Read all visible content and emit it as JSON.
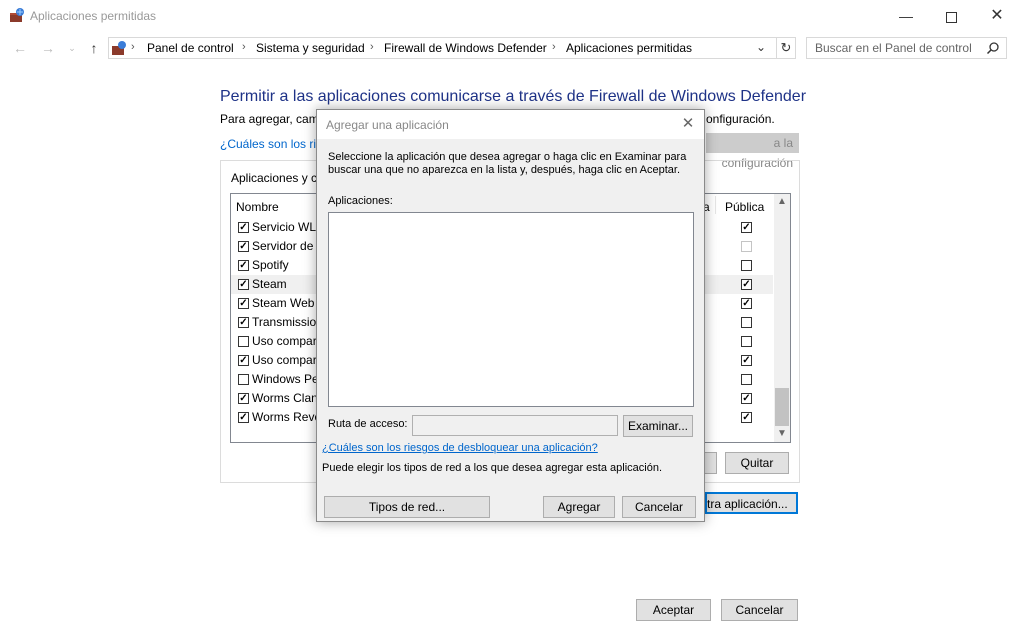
{
  "window": {
    "title": "Aplicaciones permitidas",
    "controls": [
      "minimize-icon",
      "maximize-icon",
      "close-icon"
    ]
  },
  "nav": {
    "breadcrumb": [
      "Panel de control",
      "Sistema y seguridad",
      "Firewall de Windows Defender",
      "Aplicaciones permitidas"
    ],
    "search_placeholder": "Buscar en el Panel de control"
  },
  "main": {
    "title": "Permitir a las aplicaciones comunicarse a través de Firewall de Windows Defender",
    "subtitle_start": "Para agregar, camb",
    "subtitle_end": "onfiguración.",
    "risk_link": "¿Cuáles son los ries",
    "change_settings": "a la configuración",
    "group_label": "Aplicaciones y c",
    "columns": {
      "name": "Nombre",
      "private_partial": "a",
      "public": "Pública"
    },
    "apps": [
      {
        "name": "Servicio WLA",
        "enabled": true,
        "public": true,
        "public_disabled": false
      },
      {
        "name": "Servidor de p",
        "enabled": true,
        "public": false,
        "public_disabled": true
      },
      {
        "name": "Spotify",
        "enabled": true,
        "public": false,
        "public_disabled": false
      },
      {
        "name": "Steam",
        "enabled": true,
        "public": true,
        "public_disabled": false,
        "selected": true
      },
      {
        "name": "Steam Web H",
        "enabled": true,
        "public": true,
        "public_disabled": false
      },
      {
        "name": "Transmission",
        "enabled": true,
        "public": false,
        "public_disabled": false
      },
      {
        "name": "Uso compar",
        "enabled": false,
        "public": false,
        "public_disabled": false
      },
      {
        "name": "Uso compar",
        "enabled": true,
        "public": true,
        "public_disabled": false
      },
      {
        "name": "Windows Pe",
        "enabled": false,
        "public": false,
        "public_disabled": false
      },
      {
        "name": "Worms Clan",
        "enabled": true,
        "public": true,
        "public_disabled": false
      },
      {
        "name": "Worms Revo",
        "enabled": true,
        "public": true,
        "public_disabled": false
      }
    ],
    "remove_button": "Quitar",
    "allow_other_button": "tra aplicación...",
    "ok_button": "Aceptar",
    "cancel_button": "Cancelar"
  },
  "dialog": {
    "title": "Agregar una aplicación",
    "instruction_line1": "Seleccione la aplicación que desea agregar o haga clic en Examinar para",
    "instruction_line2": "buscar una que no aparezca en la lista y, después, haga clic en Aceptar.",
    "apps_label": "Aplicaciones:",
    "path_label": "Ruta de acceso:",
    "path_value": "",
    "browse_button": "Examinar...",
    "risk_link": "¿Cuáles son los riesgos de desbloquear una aplicación?",
    "network_text": "Puede elegir los tipos de red a los que desea agregar esta aplicación.",
    "network_types_button": "Tipos de red...",
    "add_button": "Agregar",
    "cancel_button": "Cancelar"
  }
}
